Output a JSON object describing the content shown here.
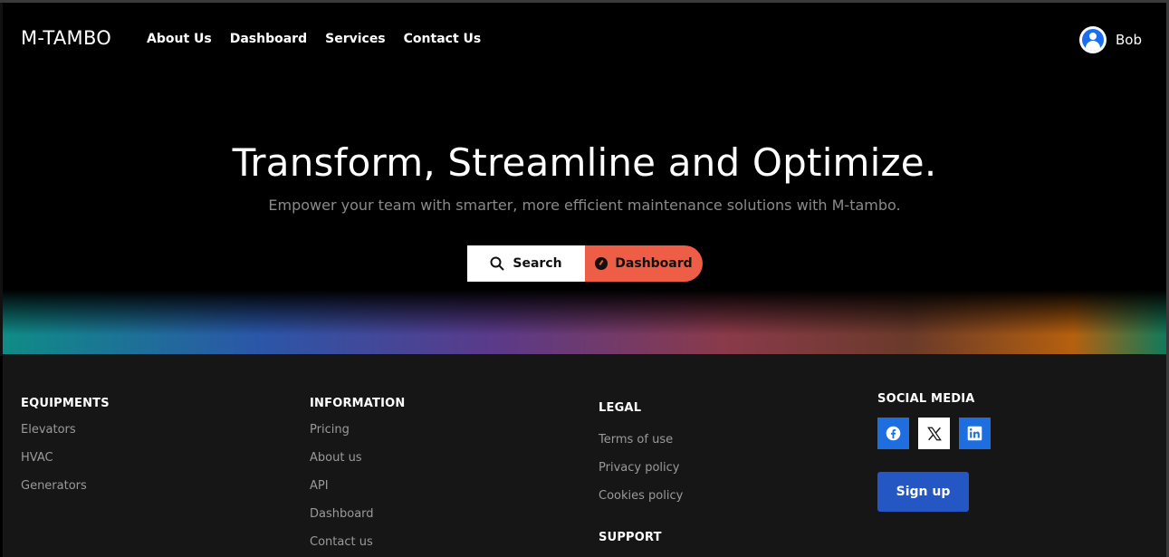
{
  "header": {
    "brand": "M-TAMBO",
    "nav": [
      "About Us",
      "Dashboard",
      "Services",
      "Contact Us"
    ],
    "user_name": "Bob"
  },
  "hero": {
    "title": "Transform, Streamline and Optimize.",
    "subtitle": "Empower your team with smarter, more efficient maintenance solutions with M-tambo.",
    "search_label": "Search",
    "dashboard_label": "Dashboard"
  },
  "footer": {
    "equipments": {
      "heading": "EQUIPMENTS",
      "items": [
        "Elevators",
        "HVAC",
        "Generators"
      ]
    },
    "information": {
      "heading": "INFORMATION",
      "items": [
        "Pricing",
        "About us",
        "API",
        "Dashboard",
        "Contact us"
      ]
    },
    "legal": {
      "heading": "LEGAL",
      "items": [
        "Terms of use",
        "Privacy policy",
        "Cookies policy"
      ]
    },
    "support": {
      "heading": "SUPPORT"
    },
    "social": {
      "heading": "SOCIAL MEDIA",
      "icons": [
        "facebook-icon",
        "x-icon",
        "linkedin-icon"
      ],
      "signup_label": "Sign up"
    }
  },
  "colors": {
    "accent": "#ee5d45",
    "primary_blue": "#2456c4",
    "social_blue": "#1f6ee0",
    "footer_bg": "#161616"
  }
}
